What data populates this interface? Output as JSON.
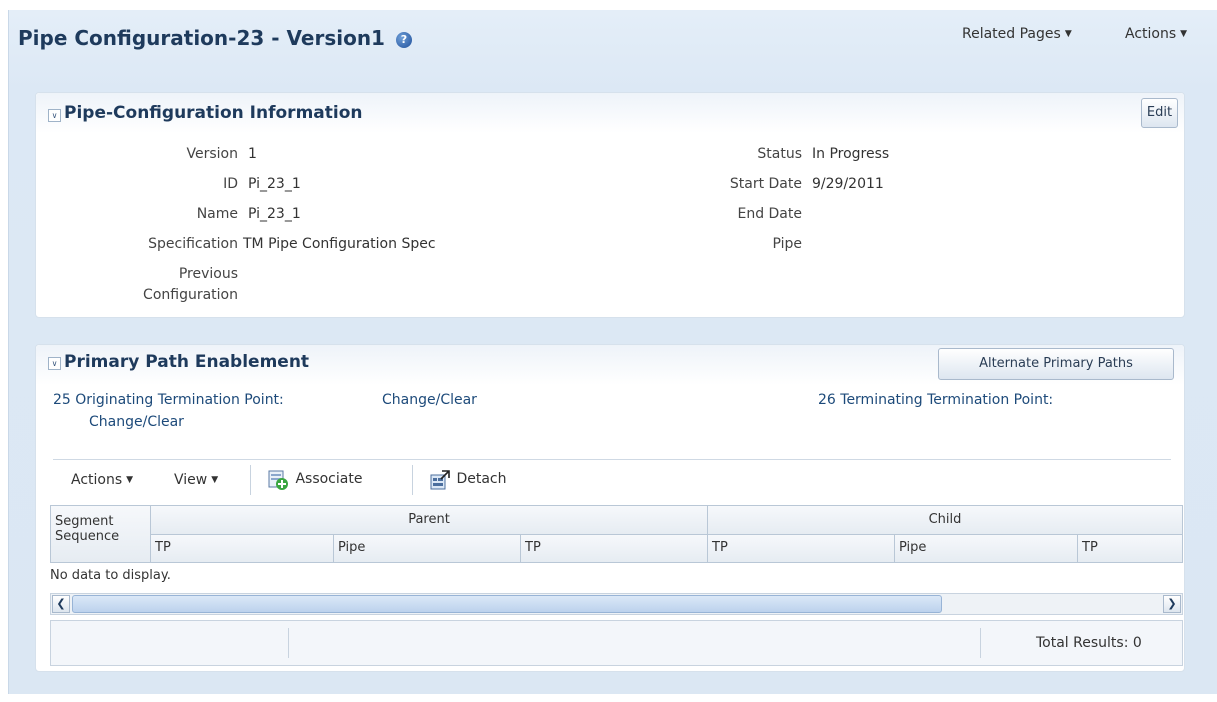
{
  "header": {
    "title": "Pipe Configuration-23 - Version1",
    "help_glyph": "?",
    "menus": {
      "related_pages": "Related Pages",
      "actions": "Actions"
    }
  },
  "info_panel": {
    "title": "Pipe-Configuration Information",
    "edit_label": "Edit",
    "left_fields": [
      {
        "label": "Version",
        "value": "1"
      },
      {
        "label": "ID",
        "value": "Pi_23_1"
      },
      {
        "label": "Name",
        "value": "Pi_23_1"
      },
      {
        "label": "Specification",
        "value": "TM Pipe Configuration Spec"
      },
      {
        "label": "Previous",
        "label2": "Configuration",
        "value": ""
      }
    ],
    "right_fields": [
      {
        "label": "Status",
        "value": "In Progress"
      },
      {
        "label": "Start Date",
        "value": "9/29/2011"
      },
      {
        "label": "End Date",
        "value": ""
      },
      {
        "label": "Pipe",
        "value": ""
      }
    ]
  },
  "path_panel": {
    "title": "Primary Path Enablement",
    "alternate_label": "Alternate Primary Paths",
    "originating_label": "25  Originating Termination Point:",
    "originating_link1": "Change/Clear",
    "originating_link2": "Change/Clear",
    "terminating_label": "26  Terminating Termination Point:",
    "toolbar": {
      "actions": "Actions",
      "view": "View",
      "associate": "Associate",
      "detach": "Detach"
    },
    "table": {
      "col_segment": "Segment",
      "col_sequence": "Sequence",
      "group_parent": "Parent",
      "group_child": "Child",
      "sub_cols": [
        "TP",
        "Pipe",
        "TP",
        "TP",
        "Pipe",
        "TP"
      ],
      "empty_text": "No data to display.",
      "total_results": "Total Results: 0"
    }
  },
  "colors": {
    "accent": "#1e3a5c",
    "link": "#1d4a7a",
    "background": "#dbe7f3"
  }
}
